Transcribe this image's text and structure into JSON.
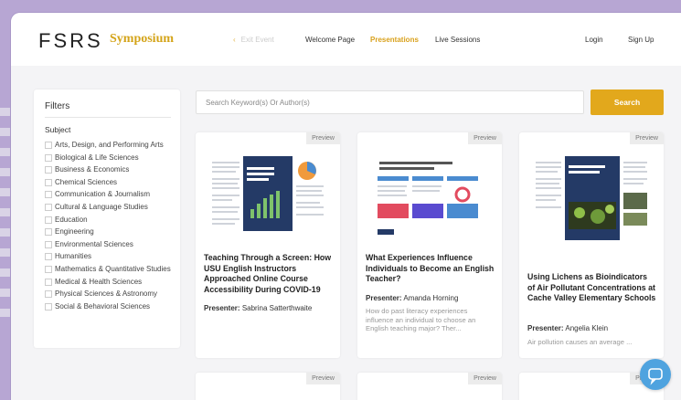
{
  "header": {
    "logo": "FSRS",
    "logo_sub": "Symposium",
    "nav": {
      "exit_event": "Exit Event",
      "welcome": "Welcome Page",
      "presentations": "Presentations",
      "live": "Live Sessions",
      "login": "Login",
      "signup": "Sign Up"
    }
  },
  "filters": {
    "title": "Filters",
    "subject_label": "Subject",
    "items": [
      "Arts, Design, and Performing Arts",
      "Biological & Life Sciences",
      "Business & Economics",
      "Chemical Sciences",
      "Communication & Journalism",
      "Cultural & Language Studies",
      "Education",
      "Engineering",
      "Environmental Sciences",
      "Humanities",
      "Mathematics & Quantitative Studies",
      "Medical & Health Sciences",
      "Physical Sciences & Astronomy",
      "Social & Behavioral Sciences"
    ]
  },
  "search": {
    "placeholder": "Search Keyword(s) Or Author(s)",
    "button": "Search"
  },
  "cards": [
    {
      "preview": "Preview",
      "title": "Teaching Through a Screen: How USU English Instructors Approached Online Course Accessibility During COVID-19",
      "presenter_label": "Presenter:",
      "presenter": "Sabrina Satterthwaite",
      "description": ""
    },
    {
      "preview": "Preview",
      "title": "What Experiences Influence Individuals to Become an English Teacher?",
      "presenter_label": "Presenter:",
      "presenter": "Amanda Horning",
      "description": "How do past literacy experiences influence an individual to choose an English teaching major? Ther..."
    },
    {
      "preview": "Preview",
      "title": "Using Lichens as Bioindicators of Air Pollutant Concentrations at Cache Valley Elementary Schools",
      "presenter_label": "Presenter:",
      "presenter": "Angelia Klein",
      "description": "Air pollution causes an average ..."
    }
  ],
  "bottom_previews": [
    "Preview",
    "Preview",
    "Preview"
  ],
  "colors": {
    "accent": "#e2a81c",
    "frame": "#b7a6d3",
    "chat": "#4fa3df"
  }
}
